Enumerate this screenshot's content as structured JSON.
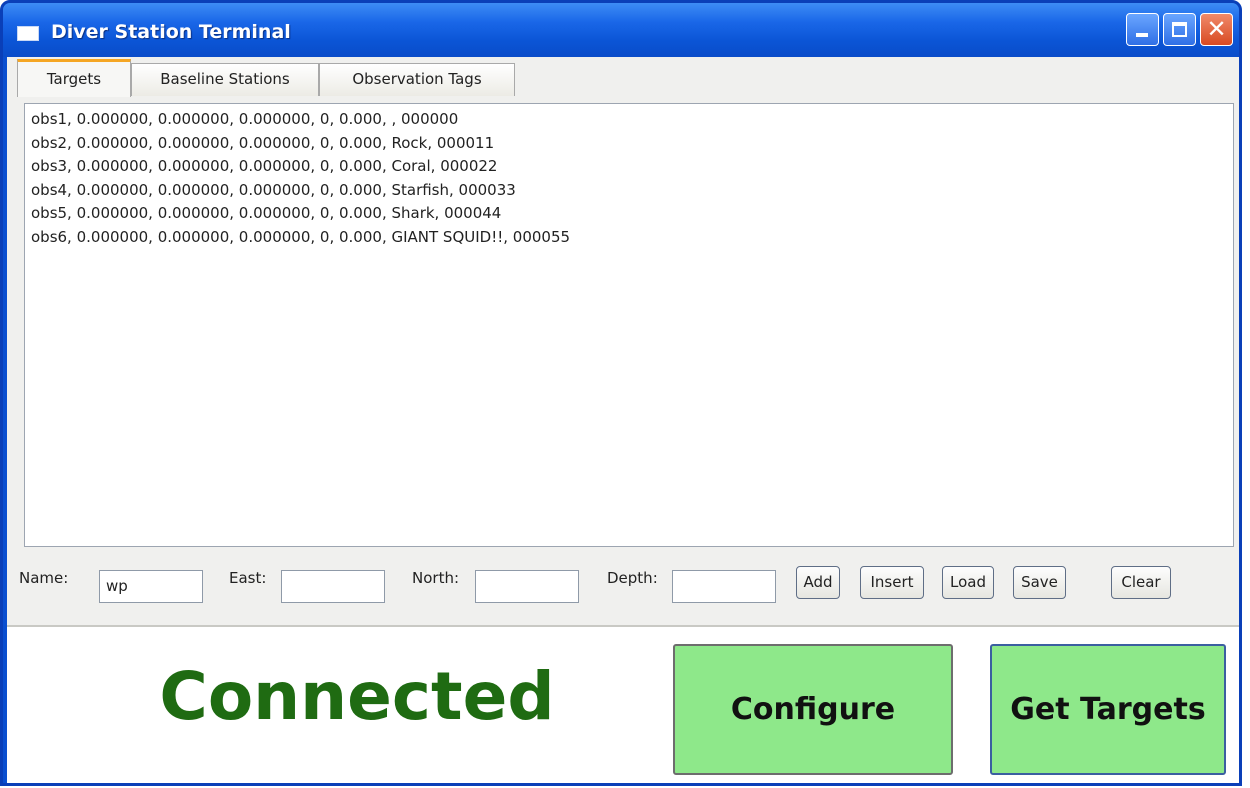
{
  "window": {
    "title": "Diver Station Terminal"
  },
  "tabs": [
    {
      "label": "Targets",
      "active": true
    },
    {
      "label": "Baseline Stations",
      "active": false
    },
    {
      "label": "Observation Tags",
      "active": false
    }
  ],
  "targets_list": [
    "obs1, 0.000000, 0.000000, 0.000000, 0, 0.000, , 000000",
    "obs2, 0.000000, 0.000000, 0.000000, 0, 0.000, Rock, 000011",
    "obs3, 0.000000, 0.000000, 0.000000, 0, 0.000, Coral, 000022",
    "obs4, 0.000000, 0.000000, 0.000000, 0, 0.000, Starfish, 000033",
    "obs5, 0.000000, 0.000000, 0.000000, 0, 0.000, Shark, 000044",
    "obs6, 0.000000, 0.000000, 0.000000, 0, 0.000, GIANT SQUID!!, 000055"
  ],
  "form": {
    "name_label": "Name:",
    "name_value": "wp",
    "east_label": "East:",
    "east_value": "",
    "north_label": "North:",
    "north_value": "",
    "depth_label": "Depth:",
    "depth_value": ""
  },
  "buttons": {
    "add": "Add",
    "insert": "Insert",
    "load": "Load",
    "save": "Save",
    "clear": "Clear",
    "configure": "Configure",
    "get_targets": "Get Targets"
  },
  "status": {
    "text": "Connected"
  },
  "colors": {
    "status_text": "#1f6b12",
    "big_button_bg": "#8ee88a",
    "active_tab_accent": "#f5a623"
  }
}
